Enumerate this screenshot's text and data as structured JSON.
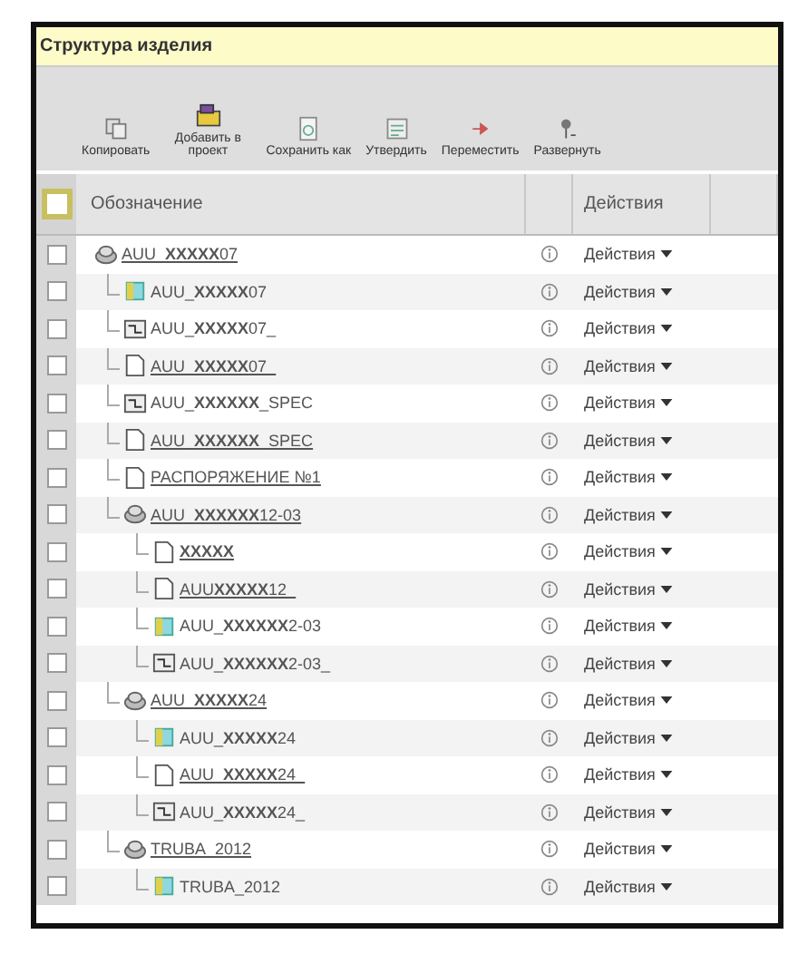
{
  "panel": {
    "title": "Структура изделия"
  },
  "toolbar": [
    {
      "label": "Копировать",
      "kind": "copy"
    },
    {
      "label": "Добавить в проект",
      "kind": "add"
    },
    {
      "label": "Сохранить как",
      "kind": "save"
    },
    {
      "label": "Утвердить",
      "kind": "approve"
    },
    {
      "label": "Переместить",
      "kind": "move"
    },
    {
      "label": "Развернуть",
      "kind": "expand"
    }
  ],
  "table": {
    "select_all": {
      "checked": false
    },
    "columns": [
      "Обозначение",
      "Действия"
    ],
    "rows": [
      {
        "name": "AUU_**XXXXX**07",
        "kind": "assembly",
        "link": true,
        "checked": false,
        "actions": "Действия",
        "children": [
          {
            "name": "AUU_**XXXXX**07",
            "kind": "part",
            "link": false,
            "checked": false,
            "actions": "Действия"
          },
          {
            "name": "AUU_**XXXXX**07_",
            "kind": "drawing",
            "link": false,
            "checked": false,
            "actions": "Действия"
          },
          {
            "name": "AUU_**XXXXX**07_",
            "kind": "document",
            "link": true,
            "checked": false,
            "actions": "Действия"
          },
          {
            "name": "AUU_**XXXXXX**_SPEC",
            "kind": "drawing",
            "link": false,
            "checked": false,
            "actions": "Действия"
          },
          {
            "name": "AUU_**XXXXXX**_SPEC",
            "kind": "document",
            "link": true,
            "checked": false,
            "actions": "Действия"
          },
          {
            "name": "РАСПОРЯЖЕНИЕ №1",
            "kind": "document",
            "link": true,
            "checked": false,
            "actions": "Действия"
          },
          {
            "name": "AUU_**XXXXXX**12-03",
            "kind": "assembly",
            "link": true,
            "checked": false,
            "actions": "Действия",
            "children": [
              {
                "name": "**XXXXX**",
                "kind": "document",
                "link": true,
                "checked": false,
                "actions": "Действия"
              },
              {
                "name": "AUU**XXXXX**12_",
                "kind": "document",
                "link": true,
                "checked": false,
                "actions": "Действия"
              },
              {
                "name": "AUU_**XXXXXX**2-03",
                "kind": "part",
                "link": false,
                "checked": false,
                "actions": "Действия"
              },
              {
                "name": "AUU_**XXXXXX**2-03_",
                "kind": "drawing",
                "link": false,
                "checked": false,
                "actions": "Действия"
              }
            ]
          },
          {
            "name": "AUU_**XXXXX**24",
            "kind": "assembly",
            "link": true,
            "checked": false,
            "actions": "Действия",
            "children": [
              {
                "name": "AUU_**XXXXX**24",
                "kind": "part",
                "link": false,
                "checked": false,
                "actions": "Действия"
              },
              {
                "name": "AUU_**XXXXX**24_",
                "kind": "document",
                "link": true,
                "checked": false,
                "actions": "Действия"
              },
              {
                "name": "AUU_**XXXXX**24_",
                "kind": "drawing",
                "link": false,
                "checked": false,
                "actions": "Действия"
              }
            ]
          },
          {
            "name": "TRUBA_2012",
            "kind": "assembly",
            "link": true,
            "checked": false,
            "actions": "Действия",
            "children": [
              {
                "name": "TRUBA_2012",
                "kind": "part",
                "link": false,
                "checked": false,
                "actions": "Действия"
              }
            ]
          }
        ]
      }
    ]
  }
}
